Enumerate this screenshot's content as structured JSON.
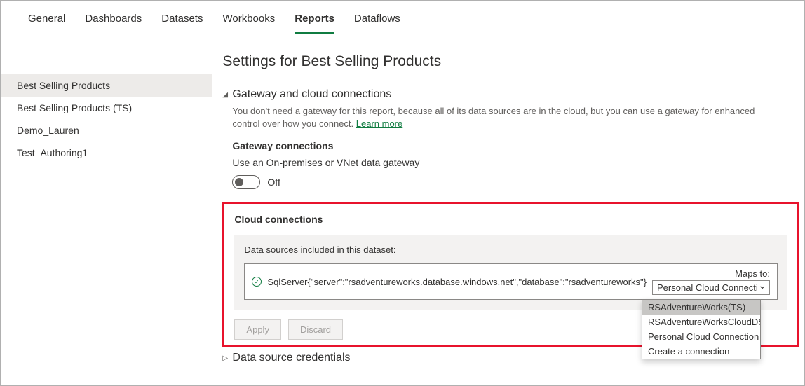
{
  "tabs": {
    "items": [
      {
        "label": "General"
      },
      {
        "label": "Dashboards"
      },
      {
        "label": "Datasets"
      },
      {
        "label": "Workbooks"
      },
      {
        "label": "Reports"
      },
      {
        "label": "Dataflows"
      }
    ]
  },
  "sidebar": {
    "items": [
      {
        "label": "Best Selling Products"
      },
      {
        "label": "Best Selling Products (TS)"
      },
      {
        "label": "Demo_Lauren"
      },
      {
        "label": "Test_Authoring1"
      }
    ]
  },
  "main": {
    "title": "Settings for Best Selling Products",
    "gateway_section": {
      "header": "Gateway and cloud connections",
      "description": "You don't need a gateway for this report, because all of its data sources are in the cloud, but you can use a gateway for enhanced control over how you connect.",
      "learn_more": "Learn more",
      "gateway_title": "Gateway connections",
      "gateway_text": "Use an On-premises or VNet data gateway",
      "toggle_state": "Off",
      "cloud_title": "Cloud connections",
      "cloud_panel_label": "Data sources included in this dataset:",
      "datasource": "SqlServer{\"server\":\"rsadventureworks.database.windows.net\",\"database\":\"rsadventureworks\"}",
      "maps_to_label": "Maps to:",
      "maps_to_value": "Personal Cloud Connecti",
      "dropdown_options": [
        "RSAdventureWorks(TS)",
        "RSAdventureWorksCloudDS",
        "Personal Cloud Connection",
        "Create a connection"
      ],
      "apply_label": "Apply",
      "discard_label": "Discard"
    },
    "credentials_section": {
      "header": "Data source credentials"
    }
  }
}
